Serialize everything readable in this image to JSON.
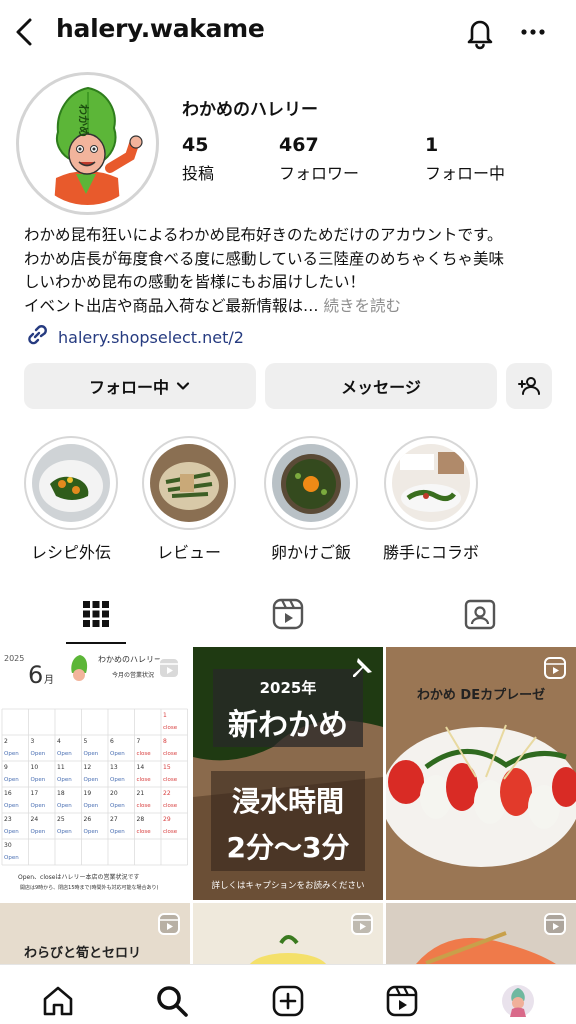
{
  "header": {
    "username": "halery.wakame"
  },
  "profile": {
    "display_name": "わかめのハレリー",
    "avatar_text": "わかめ",
    "stats": [
      {
        "value": "45",
        "label": "投稿"
      },
      {
        "value": "467",
        "label": "フォロワー"
      },
      {
        "value": "1",
        "label": "フォロー中"
      }
    ],
    "bio_lines": [
      "わかめ昆布狂いによるわかめ昆布好きのためだけのアカウントです。",
      "わかめ店長が毎度食べる度に感動している三陸産のめちゃくちゃ美味",
      "しいわかめ昆布の感動を皆様にもお届けしたい！",
      "イベント出店や商品入荷など最新情報は…"
    ],
    "bio_more": "続きを読む",
    "link": "halery.shopselect.net/2"
  },
  "actions": {
    "following": "フォロー中",
    "message": "メッセージ"
  },
  "highlights": [
    {
      "label": "レシピ外伝"
    },
    {
      "label": "レビュー"
    },
    {
      "label": "卵かけご飯"
    },
    {
      "label": "勝手にコラボ"
    }
  ],
  "posts": {
    "calendar": {
      "year": "2025",
      "month": "6",
      "month_suffix": "月",
      "title": "わかめのハレリー",
      "subtitle": "今月の営業状況",
      "footer1": "Open、closeはハレリー本店の営業状況です",
      "footer2": "開店は9時から、閉店15時まで(時間外も対応可能な場合あり)",
      "open": "Open",
      "close": "close"
    },
    "shinwakame": {
      "year": "2025年",
      "title": "新わかめ",
      "line1": "浸水時間",
      "line2": "2分〜3分",
      "caption": "詳しくはキャプションをお読みください"
    },
    "caprese": {
      "title": "わかめ DEカプレーゼ"
    },
    "warabi": {
      "title": "わらびと筍とセロリ"
    }
  },
  "colors": {
    "link": "#263b80",
    "button_bg": "#efefef",
    "wakame_green": "#5cb638",
    "close_red": "#d84040",
    "open_blue": "#4a6fb3"
  }
}
